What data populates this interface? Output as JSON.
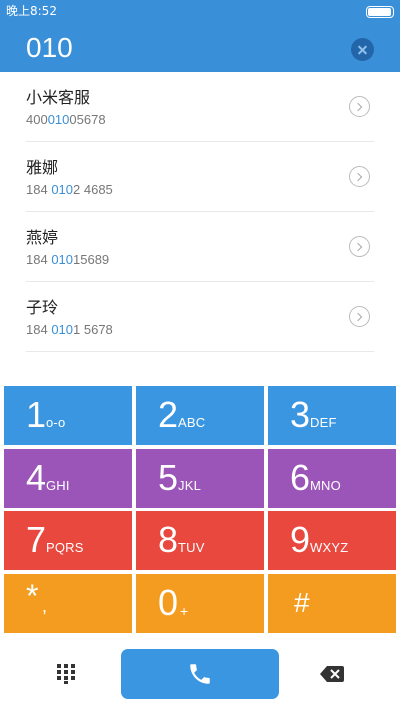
{
  "status_bar": {
    "time": "晚上8:52",
    "battery_level": 0.95
  },
  "dialer": {
    "input": "010",
    "clear_icon": "clear-circle-icon"
  },
  "contacts": [
    {
      "name": "小米客服",
      "number_parts": [
        "400",
        "010",
        "05678"
      ]
    },
    {
      "name": "雅娜",
      "number_parts": [
        "184 ",
        "010",
        "2 4685"
      ]
    },
    {
      "name": "燕婷",
      "number_parts": [
        "184 ",
        "010",
        "15689"
      ]
    },
    {
      "name": "子玲",
      "number_parts": [
        "184 ",
        "010",
        "1 5678"
      ]
    }
  ],
  "keypad": {
    "keys": [
      {
        "digit": "1",
        "letters": "o-o"
      },
      {
        "digit": "2",
        "letters": "ABC"
      },
      {
        "digit": "3",
        "letters": "DEF"
      },
      {
        "digit": "4",
        "letters": "GHI"
      },
      {
        "digit": "5",
        "letters": "JKL"
      },
      {
        "digit": "6",
        "letters": "MNO"
      },
      {
        "digit": "7",
        "letters": "PQRS"
      },
      {
        "digit": "8",
        "letters": "TUV"
      },
      {
        "digit": "9",
        "letters": "WXYZ"
      },
      {
        "symbol": "*",
        "sub": ","
      },
      {
        "digit": "0",
        "sub": "+"
      },
      {
        "symbol": "#"
      }
    ],
    "colors": {
      "row1": "#3a96e0",
      "row2": "#9b55b8",
      "row3": "#e8483e",
      "row4": "#f39c1f"
    }
  },
  "bottom_bar": {
    "grid_icon": "keypad-grid-icon",
    "call_icon": "phone-icon",
    "backspace_icon": "backspace-icon"
  },
  "colors": {
    "accent": "#3a8fd9",
    "highlight": "#3a8fd9"
  }
}
